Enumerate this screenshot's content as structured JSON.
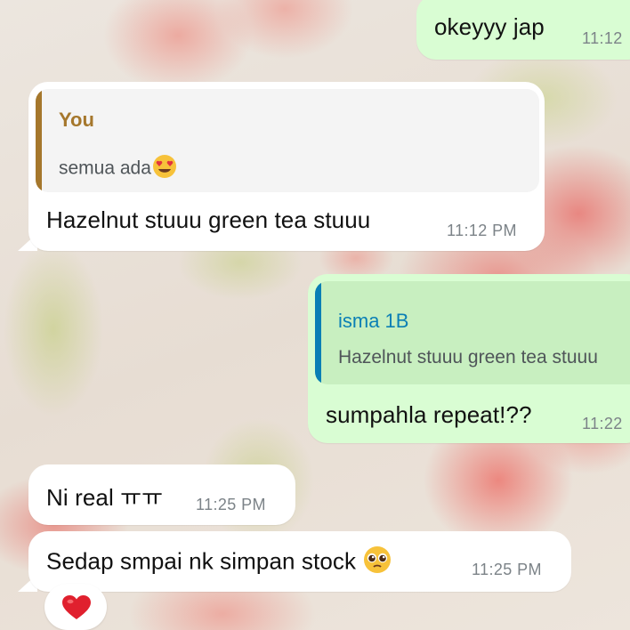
{
  "messages": [
    {
      "id": "m1",
      "direction": "out",
      "text": "okeyyy jap",
      "time": "11:12"
    },
    {
      "id": "m2",
      "direction": "in",
      "reply": {
        "author": "You",
        "text": "semua ada",
        "emoji": "heart-eyes-emoji"
      },
      "text": "Hazelnut stuuu green tea stuuu",
      "time": "11:12 PM"
    },
    {
      "id": "m3",
      "direction": "out",
      "reply": {
        "author": "isma 1B",
        "text": "Hazelnut stuuu green tea stuuu"
      },
      "text": "sumpahla repeat!??",
      "time": "11:22"
    },
    {
      "id": "m4",
      "direction": "in",
      "text": "Ni real ㅠㅠ",
      "time": "11:25 PM"
    },
    {
      "id": "m5",
      "direction": "in",
      "text": "Sedap smpai nk simpan stock",
      "emoji": "pleading-face-emoji",
      "time": "11:25 PM",
      "reaction": "red-heart-emoji"
    }
  ],
  "colors": {
    "incoming_bubble": "#ffffff",
    "outgoing_bubble": "#d9fdd3",
    "you_accent": "#a5772c",
    "contact_accent": "#0a7fb5",
    "time_text": "#7c8388"
  }
}
